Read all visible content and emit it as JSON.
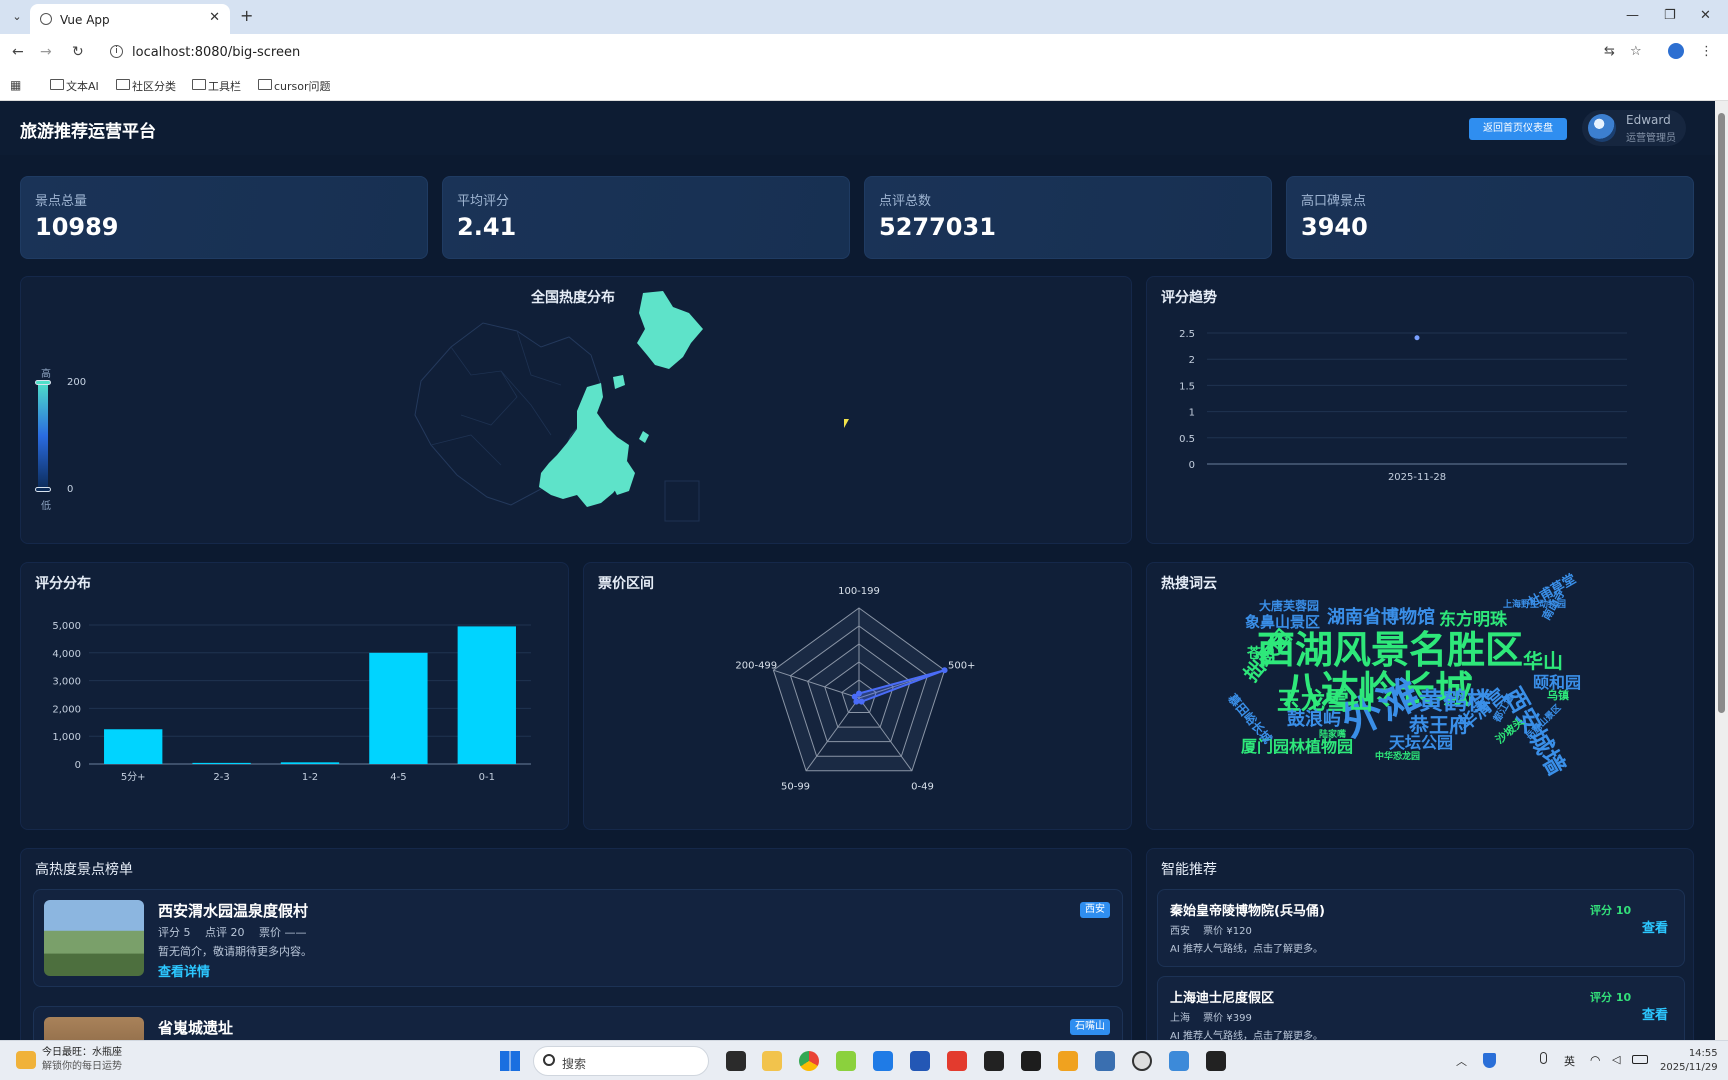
{
  "browser": {
    "tab_title": "Vue App",
    "url": "localhost:8080/big-screen",
    "bookmarks": [
      "文本AI",
      "社区分类",
      "工具栏",
      "cursor问题"
    ]
  },
  "header": {
    "title": "旅游推荐运营平台",
    "back_button": "返回首页仪表盘",
    "user_name": "Edward",
    "user_role": "运营管理员"
  },
  "stats": [
    {
      "label": "景点总量",
      "value": "10989"
    },
    {
      "label": "平均评分",
      "value": "2.41"
    },
    {
      "label": "点评总数",
      "value": "5277031"
    },
    {
      "label": "高口碑景点",
      "value": "3940"
    }
  ],
  "map": {
    "title": "全国热度分布",
    "legend_high": "高",
    "legend_low": "低",
    "legend_max": "200",
    "legend_min": "0",
    "colors": {
      "high": "#4fe0c8",
      "low": "#0b2a56",
      "fill": "#5ee3c9"
    }
  },
  "panels": {
    "trend_title": "评分趋势",
    "rating_title": "评分分布",
    "price_title": "票价区间",
    "cloud_title": "热搜词云",
    "rank_title": "高热度景点榜单",
    "rec_title": "智能推荐"
  },
  "chart_data": [
    {
      "type": "line",
      "title": "评分趋势",
      "x": [
        "2025-11-28"
      ],
      "y_ticks": [
        "0",
        "0.5",
        "1",
        "1.5",
        "2",
        "2.5"
      ],
      "series": [
        {
          "values": [
            2.41
          ]
        }
      ],
      "ylim": [
        0,
        2.5
      ]
    },
    {
      "type": "bar",
      "title": "评分分布",
      "categories": [
        "5分+",
        "2-3",
        "1-2",
        "4-5",
        "0-1"
      ],
      "values": [
        1250,
        40,
        60,
        4000,
        4950
      ],
      "y_ticks": [
        "0",
        "1,000",
        "2,000",
        "3,000",
        "4,000",
        "5,000"
      ],
      "ylim": [
        0,
        5000
      ],
      "color": "#00d4ff"
    },
    {
      "type": "radar",
      "title": "票价区间",
      "categories": [
        "100-199",
        "500+",
        "0-49",
        "50-99",
        "200-499"
      ],
      "values": [
        0.05,
        1.0,
        0.05,
        0.05,
        0.05
      ],
      "color": "#4a6cf7"
    }
  ],
  "word_cloud": [
    {
      "text": "西湖风景名胜区",
      "size": 38,
      "color": "#2ee87a"
    },
    {
      "text": "八达岭长城",
      "size": 38,
      "color": "#2ee87a"
    },
    {
      "text": "外滩",
      "size": 40,
      "color": "#3a8fe8"
    },
    {
      "text": "湖南省博物馆",
      "size": 18,
      "color": "#3a8fe8"
    },
    {
      "text": "东方明珠",
      "size": 17,
      "color": "#2ee87a"
    },
    {
      "text": "象鼻山景区",
      "size": 15,
      "color": "#3a8fe8"
    },
    {
      "text": "大唐芙蓉园",
      "size": 12,
      "color": "#3a8fe8"
    },
    {
      "text": "上海野生动物园",
      "size": 9,
      "color": "#3a8fe8"
    },
    {
      "text": "玉龙雪山",
      "size": 24,
      "color": "#2ee87a"
    },
    {
      "text": "黄鹤楼",
      "size": 24,
      "color": "#3a8fe8"
    },
    {
      "text": "华山",
      "size": 20,
      "color": "#2ee87a"
    },
    {
      "text": "苍山",
      "size": 14,
      "color": "#2ee87a"
    },
    {
      "text": "拙政园",
      "size": 20,
      "color": "#2ee87a"
    },
    {
      "text": "鼓浪屿",
      "size": 18,
      "color": "#3a8fe8"
    },
    {
      "text": "恭王府",
      "size": 20,
      "color": "#3a8fe8"
    },
    {
      "text": "颐和园",
      "size": 16,
      "color": "#3a8fe8"
    },
    {
      "text": "西安城墙",
      "size": 24,
      "color": "#3a8fe8"
    },
    {
      "text": "天坛公园",
      "size": 16,
      "color": "#3a8fe8"
    },
    {
      "text": "厦门园林植物园",
      "size": 16,
      "color": "#2ee87a"
    },
    {
      "text": "华清宫",
      "size": 18,
      "color": "#3a8fe8"
    },
    {
      "text": "杜甫草堂",
      "size": 13,
      "color": "#3a8fe8"
    },
    {
      "text": "乌镇",
      "size": 11,
      "color": "#2ee87a"
    },
    {
      "text": "慕田峪长城",
      "size": 12,
      "color": "#3a8fe8"
    },
    {
      "text": "中华恐龙园",
      "size": 9,
      "color": "#2ee87a"
    },
    {
      "text": "陆家嘴",
      "size": 9,
      "color": "#2ee87a"
    },
    {
      "text": "沙坡头",
      "size": 11,
      "color": "#2ee87a"
    },
    {
      "text": "南山寺",
      "size": 11,
      "color": "#3a8fe8"
    },
    {
      "text": "都江堰",
      "size": 10,
      "color": "#3a8fe8"
    },
    {
      "text": "岳麓山景区",
      "size": 9,
      "color": "#3a8fe8"
    }
  ],
  "ranking": [
    {
      "name": "西安渭水园温泉度假村",
      "meta": "评分 5　 点评 20　 票价 ——",
      "desc": "暂无简介，敬请期待更多内容。",
      "link": "查看详情",
      "tag": "西安"
    },
    {
      "name": "省嵬城遗址",
      "tag": "石嘴山"
    }
  ],
  "recommend": [
    {
      "name": "秦始皇帝陵博物院(兵马俑)",
      "meta": "西安　 票价 ¥120",
      "desc": "AI 推荐人气路线，点击了解更多。",
      "score": "评分 10",
      "view": "查看"
    },
    {
      "name": "上海迪士尼度假区",
      "meta": "上海　 票价 ¥399",
      "desc": "AI 推荐人气路线，点击了解更多。",
      "score": "评分 10",
      "view": "查看"
    }
  ],
  "taskbar": {
    "search": "搜索",
    "weather_title": "今日最旺：水瓶座",
    "weather_sub": "解锁你的每日运势",
    "time": "14:55",
    "date": "2025/11/29",
    "ime": "英"
  }
}
